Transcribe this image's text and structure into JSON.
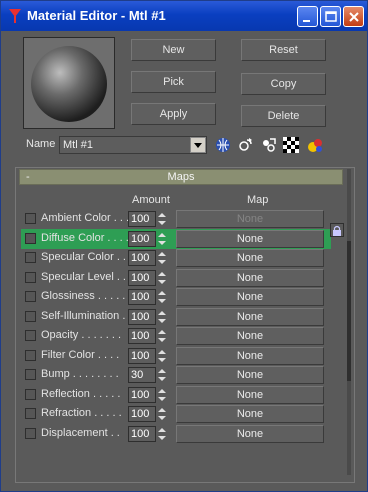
{
  "window": {
    "title": "Material Editor - Mtl #1"
  },
  "buttons": {
    "new": "New",
    "reset": "Reset",
    "pick": "Pick",
    "copy": "Copy",
    "apply": "Apply",
    "delete": "Delete"
  },
  "name": {
    "label": "Name",
    "value": "Mtl #1"
  },
  "maps": {
    "title": "Maps",
    "collapse": "-",
    "amount_header": "Amount",
    "map_header": "Map",
    "rows": [
      {
        "label": "Ambient Color . . .",
        "amount": "100",
        "map": "None"
      },
      {
        "label": "Diffuse Color . . . .",
        "amount": "100",
        "map": "None"
      },
      {
        "label": "Specular Color . .",
        "amount": "100",
        "map": "None"
      },
      {
        "label": "Specular Level . .",
        "amount": "100",
        "map": "None"
      },
      {
        "label": "Glossiness . . . . .",
        "amount": "100",
        "map": "None"
      },
      {
        "label": "Self-Illumination .",
        "amount": "100",
        "map": "None"
      },
      {
        "label": "Opacity . . . . . . .",
        "amount": "100",
        "map": "None"
      },
      {
        "label": "Filter Color . . . .",
        "amount": "100",
        "map": "None"
      },
      {
        "label": "Bump . . . . . . . .",
        "amount": "30",
        "map": "None"
      },
      {
        "label": "Reflection . . . . .",
        "amount": "100",
        "map": "None"
      },
      {
        "label": "Refraction . . . . .",
        "amount": "100",
        "map": "None"
      },
      {
        "label": "Displacement . .",
        "amount": "100",
        "map": "None"
      }
    ]
  },
  "colors": {
    "highlight": "#2e9e54",
    "titlebar": "#0a3fc0",
    "panel": "#5a5a5a"
  }
}
